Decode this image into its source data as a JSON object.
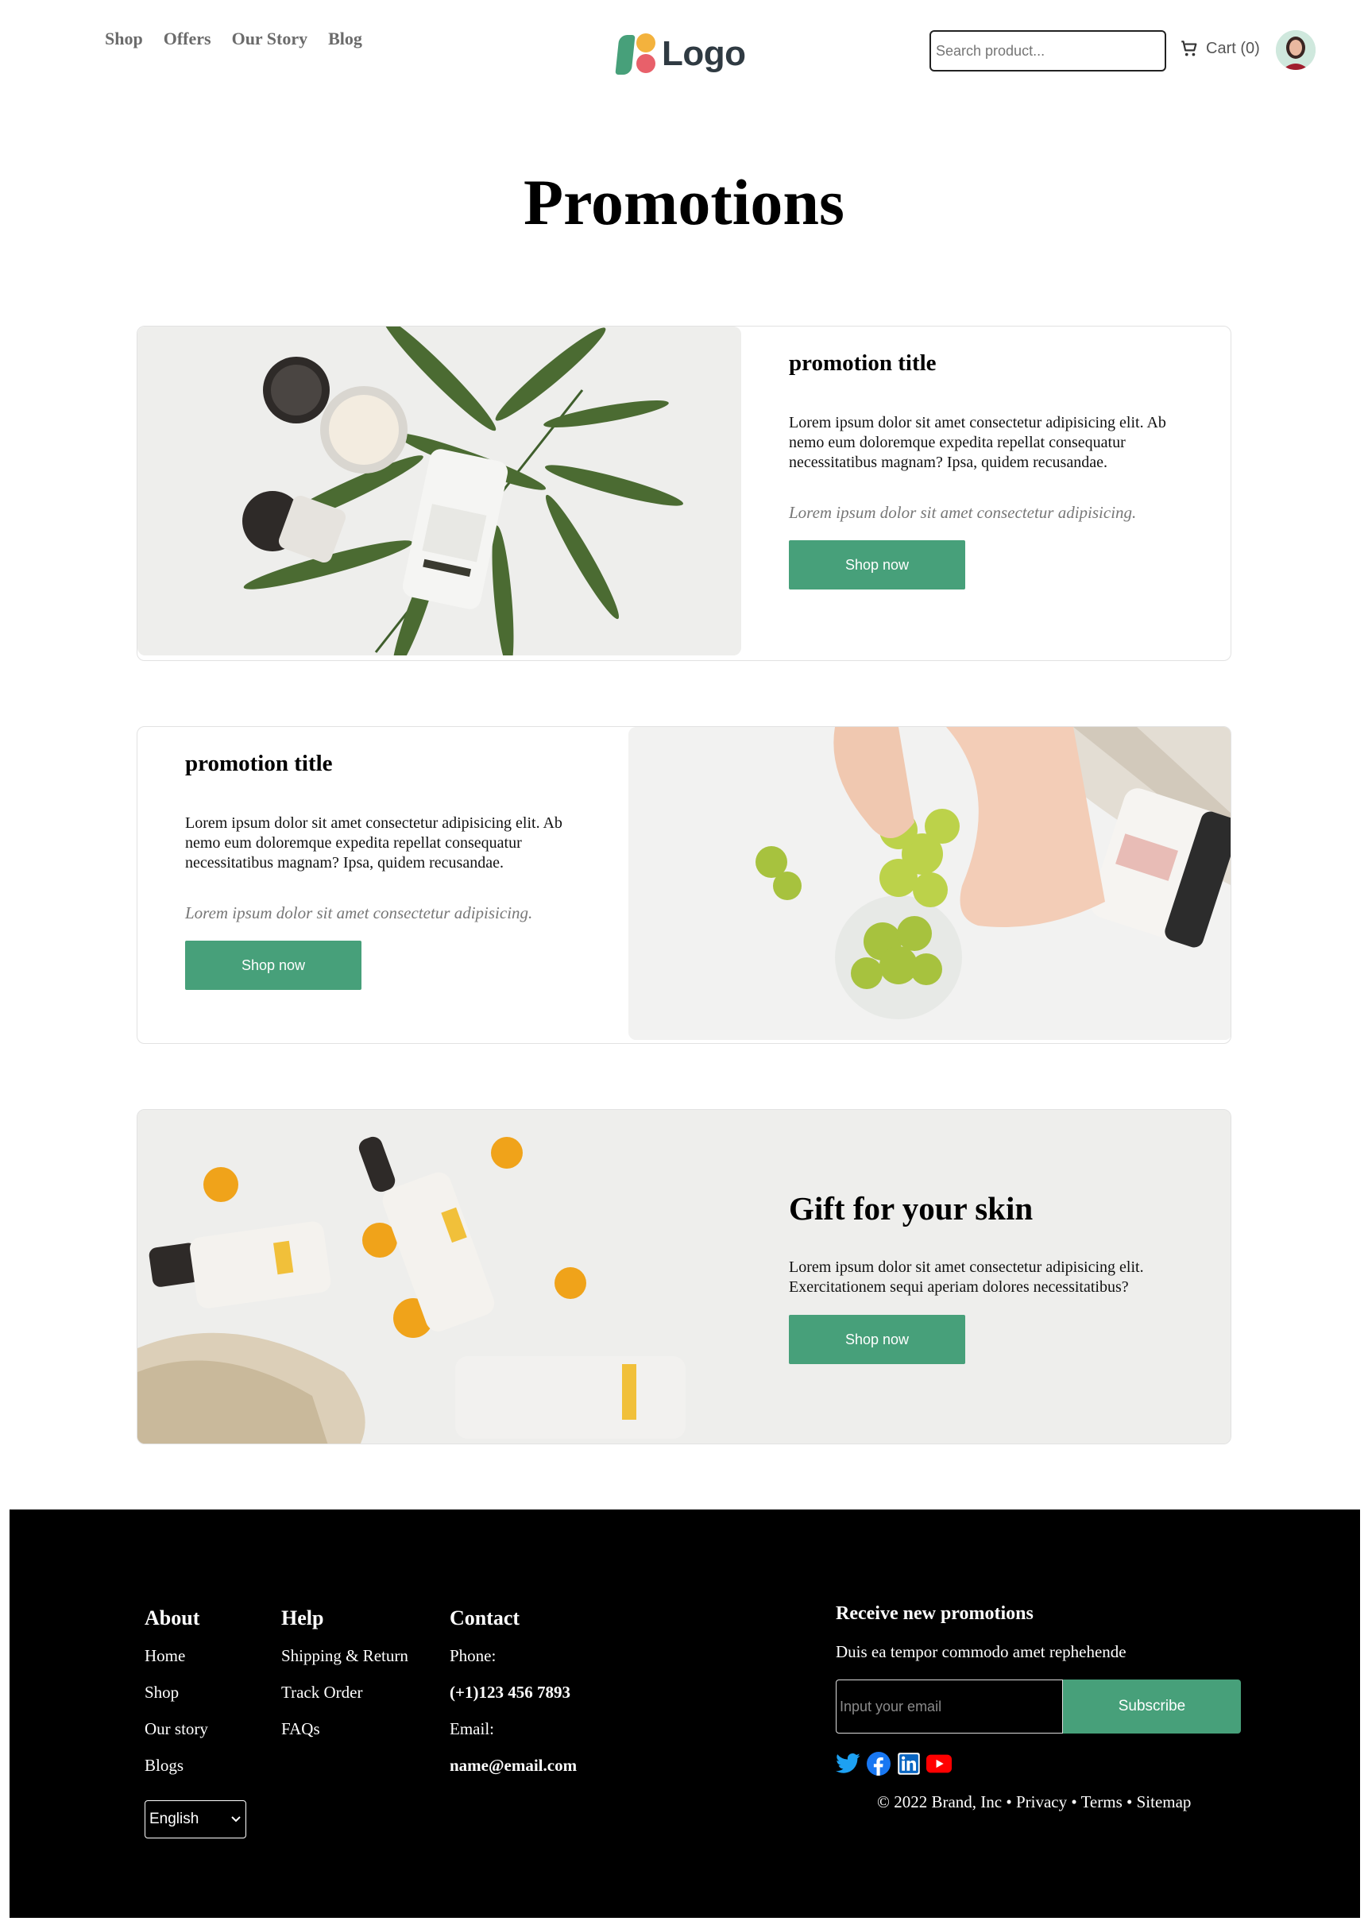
{
  "header": {
    "nav": [
      "Shop",
      "Offers",
      "Our Story",
      "Blog"
    ],
    "logo_text": "Logo",
    "search_placeholder": "Search product...",
    "cart_label": "Cart (0)"
  },
  "page_title": "Promotions",
  "promos": [
    {
      "title": "promotion title",
      "body": "Lorem ipsum dolor sit amet consectetur adipisicing elit. Ab nemo eum doloremque expedita repellat consequatur necessitatibus magnam? Ipsa, quidem recusandae.",
      "note": "Lorem ipsum dolor sit amet consectetur adipisicing.",
      "button": "Shop now"
    },
    {
      "title": "promotion title",
      "body": "Lorem ipsum dolor sit amet consectetur adipisicing elit. Ab nemo eum doloremque expedita repellat consequatur necessitatibus magnam? Ipsa, quidem recusandae.",
      "note": "Lorem ipsum dolor sit amet consectetur adipisicing.",
      "button": "Shop now"
    },
    {
      "title": "Gift for your skin",
      "body": "Lorem ipsum dolor sit amet consectetur adipisicing elit. Exercitationem sequi aperiam dolores necessitatibus?",
      "button": "Shop now"
    }
  ],
  "footer": {
    "about": {
      "heading": "About",
      "links": [
        "Home",
        "Shop",
        "Our story",
        "Blogs"
      ]
    },
    "help": {
      "heading": "Help",
      "links": [
        "Shipping & Return",
        "Track Order",
        "FAQs"
      ]
    },
    "contact": {
      "heading": "Contact",
      "phone_label": "Phone:",
      "phone": "(+1)123 456 7893",
      "email_label": "Email:",
      "email": "name@email.com"
    },
    "language": "English",
    "newsletter": {
      "heading": "Receive new promotions",
      "subtext": "Duis ea tempor commodo amet rephehende",
      "email_placeholder": "Input your email",
      "button": "Subscribe"
    },
    "socials": [
      "twitter-icon",
      "facebook-icon",
      "linkedin-icon",
      "youtube-icon"
    ],
    "copyright": "© 2022 Brand, Inc • Privacy • Terms • Sitemap"
  },
  "colors": {
    "accent": "#47a07a",
    "footer_bg": "#000000",
    "nav_text": "#6b6b6b"
  }
}
